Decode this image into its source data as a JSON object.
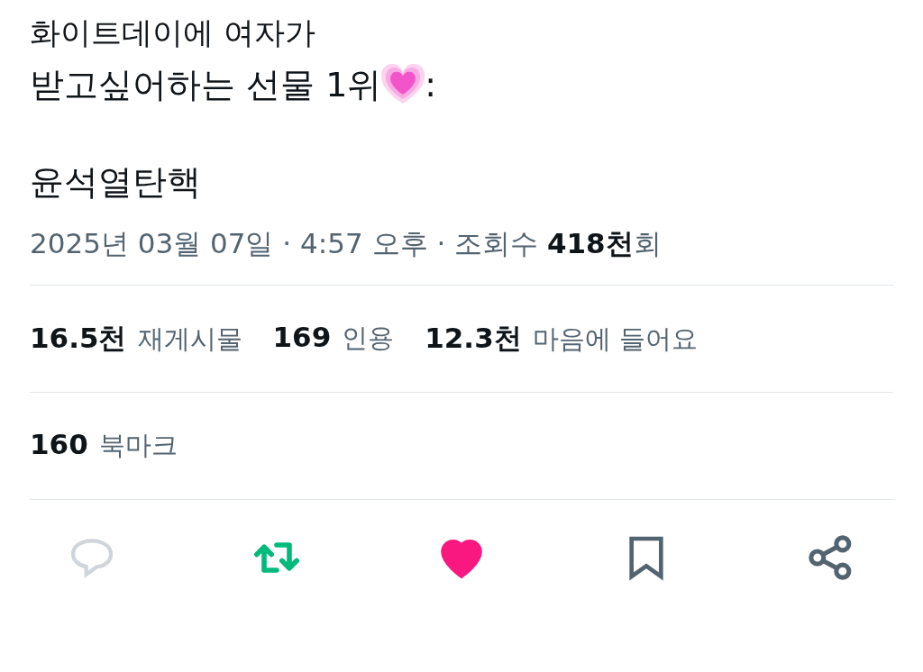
{
  "tweet": {
    "lines": [
      "화이트데이에 여자가",
      "받고싶어하는 선물 1위"
    ],
    "line_suffix": ":",
    "hashtag_line": "윤석열탄핵",
    "meta": "2025년 03월 07일 · 4:57 오후 · 조회수 **418천**회"
  },
  "stats": [
    [
      {
        "count": "16.5천",
        "label": "재게시물"
      },
      {
        "count": "169",
        "label": "인용"
      },
      {
        "count": "12.3천",
        "label": "마음에 들어요"
      }
    ],
    [
      {
        "count": "160",
        "label": "북마크"
      }
    ]
  ],
  "actions": [
    {
      "kind": "reply",
      "on": false
    },
    {
      "kind": "repost",
      "on": true
    },
    {
      "kind": "like",
      "on": true
    },
    {
      "kind": "bookmark",
      "on": false
    },
    {
      "kind": "share",
      "on": false
    }
  ]
}
